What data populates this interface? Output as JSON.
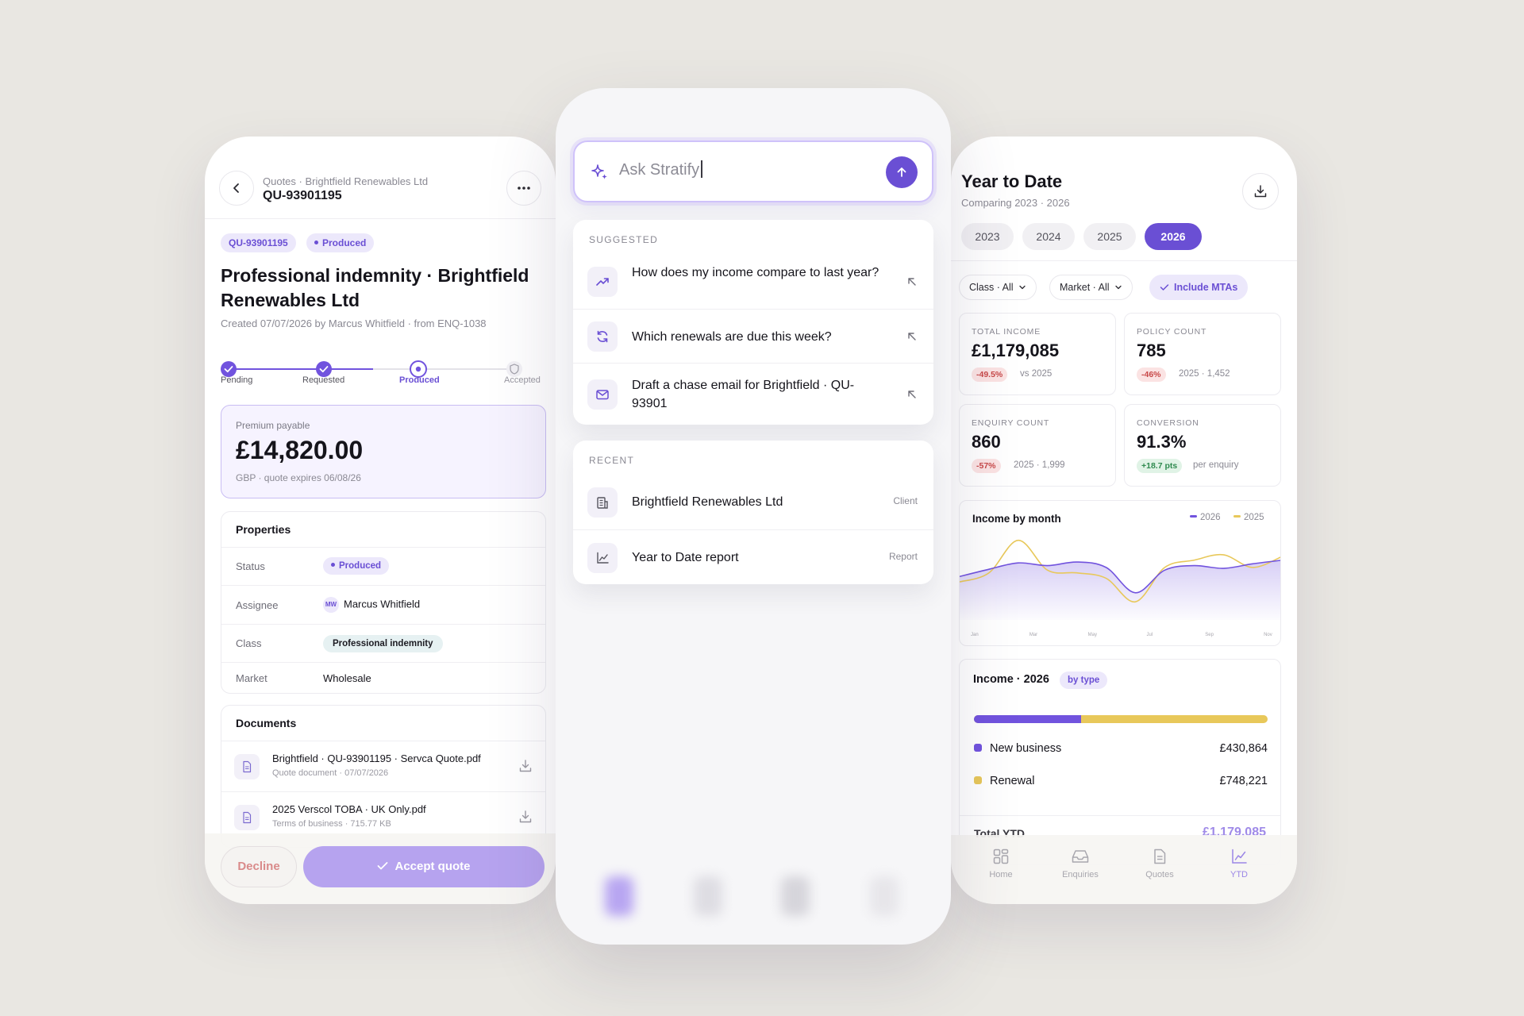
{
  "quote": {
    "breadcrumb": "Quotes · Brightfield Renewables Ltd",
    "id": "QU-93901195",
    "status_chip": "Produced",
    "title": "Professional indemnity · Brightfield Renewables Ltd",
    "created": "Created 07/07/2026 by Marcus Whitfield · from ENQ-1038",
    "steps": [
      "Pending",
      "Requested",
      "Produced",
      "Accepted"
    ],
    "premium": {
      "label": "Premium payable",
      "value": "£14,820.00",
      "sub": "GBP · quote expires 06/08/26"
    },
    "properties": {
      "heading": "Properties",
      "status_label": "Status",
      "status_value": "Produced",
      "assignee_label": "Assignee",
      "assignee_initials": "MW",
      "assignee_value": "Marcus Whitfield",
      "class_label": "Class",
      "class_value": "Professional indemnity",
      "market_label": "Market",
      "market_value": "Wholesale"
    },
    "documents": {
      "heading": "Documents",
      "items": [
        {
          "name": "Brightfield · QU-93901195 · Servca Quote.pdf",
          "meta": "Quote document · 07/07/2026"
        },
        {
          "name": "2025 Verscol TOBA · UK Only.pdf",
          "meta": "Terms of business · 715.77 KB"
        }
      ]
    },
    "decline_label": "Decline",
    "accept_label": "Accept quote"
  },
  "assistant": {
    "placeholder": "Ask Stratify",
    "suggested_heading": "SUGGESTED",
    "suggestions": [
      {
        "icon": "trending-up-icon",
        "text": "How does my income compare to last year?"
      },
      {
        "icon": "refresh-icon",
        "text": "Which renewals are due this week?"
      },
      {
        "icon": "mail-icon",
        "text": "Draft a chase email for Brightfield · QU-93901"
      }
    ],
    "recent_heading": "RECENT",
    "recent": [
      {
        "icon": "building-icon",
        "text": "Brightfield Renewables Ltd",
        "tag": "Client"
      },
      {
        "icon": "chart-icon",
        "text": "Year to Date report",
        "tag": "Report"
      }
    ]
  },
  "ytd": {
    "title": "Year to Date",
    "subtitle": "Comparing 2023 · 2026",
    "years": [
      "2023",
      "2024",
      "2025",
      "2026"
    ],
    "active_year": "2026",
    "filters": [
      "Class · All",
      "Market · All",
      "Include MTAs"
    ],
    "kpis": [
      {
        "label": "TOTAL INCOME",
        "value": "£1,179,085",
        "badge": "-49.5%",
        "note": "vs 2025",
        "trend": "neg"
      },
      {
        "label": "POLICY COUNT",
        "value": "785",
        "badge": "-46%",
        "note": "2025 · 1,452",
        "trend": "neg"
      },
      {
        "label": "ENQUIRY COUNT",
        "value": "860",
        "badge": "-57%",
        "note": "2025 · 1,999",
        "trend": "neg"
      },
      {
        "label": "CONVERSION",
        "value": "91.3%",
        "badge": "+18.7 pts",
        "note": "per enquiry",
        "trend": "pos"
      }
    ],
    "income_by_type": {
      "heading": "Income · 2026",
      "chip": "by type",
      "new_business_share": 0.365,
      "rows": [
        {
          "label": "New business",
          "value": "£430,864",
          "color": "#7153de"
        },
        {
          "label": "Renewal",
          "value": "£748,221",
          "color": "#e8c85a"
        }
      ],
      "total_label": "Total YTD",
      "total_value": "£1,179,085"
    },
    "tabs": [
      {
        "label": "Home",
        "icon": "home-grid-icon"
      },
      {
        "label": "Enquiries",
        "icon": "inbox-icon"
      },
      {
        "label": "Quotes",
        "icon": "document-icon"
      },
      {
        "label": "YTD",
        "icon": "chart-line-icon"
      }
    ],
    "active_tab": "YTD"
  },
  "chart_data": {
    "type": "line",
    "title": "Income by month",
    "x": [
      "Jan",
      "Feb",
      "Mar",
      "Apr",
      "May",
      "Jun",
      "Jul",
      "Aug",
      "Sep",
      "Oct",
      "Nov",
      "Dec"
    ],
    "x_ticks": [
      "Jan",
      "Mar",
      "May",
      "Jul",
      "Sep",
      "Nov"
    ],
    "series": [
      {
        "name": "2026",
        "color": "#7153de",
        "values": [
          48,
          56,
          63,
          60,
          64,
          58,
          30,
          55,
          60,
          57,
          62,
          66
        ]
      },
      {
        "name": "2025",
        "color": "#e8c85a",
        "values": [
          42,
          52,
          88,
          55,
          52,
          46,
          20,
          58,
          66,
          72,
          58,
          70
        ]
      }
    ],
    "ylim": [
      0,
      100
    ],
    "grid": false,
    "legend": "top-right"
  }
}
